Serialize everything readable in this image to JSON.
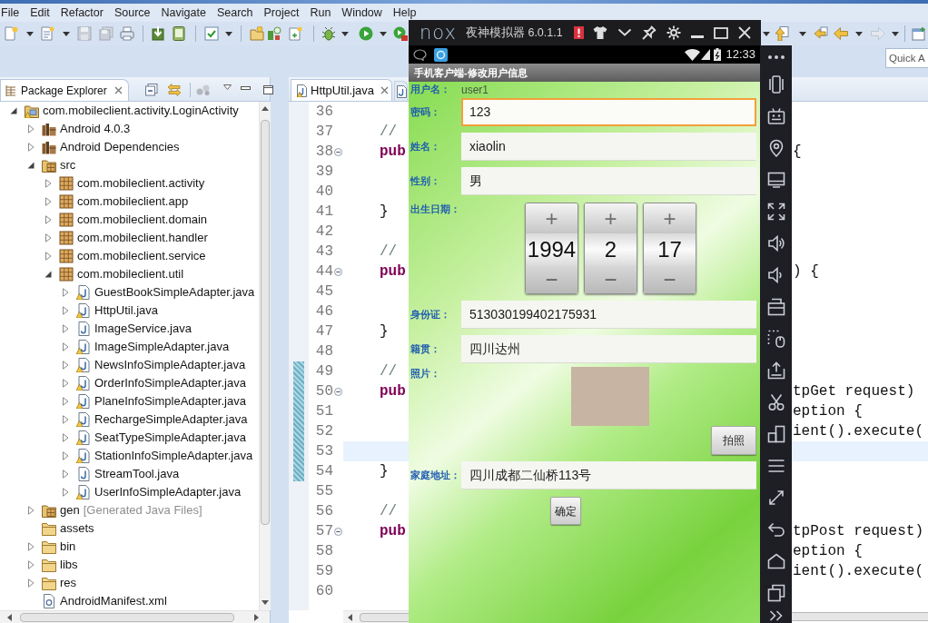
{
  "menu_bar": {
    "items": [
      "File",
      "Edit",
      "Refactor",
      "Source",
      "Navigate",
      "Search",
      "Project",
      "Run",
      "Window",
      "Help"
    ]
  },
  "quick_access": {
    "placeholder": "Quick A"
  },
  "package_explorer": {
    "title": "Package Explorer",
    "tree": [
      {
        "label": "com.mobileclient.activity.LoginActivity",
        "kind": "project",
        "expanded": true,
        "children": [
          {
            "label": "Android 4.0.3",
            "kind": "library",
            "expanded": false
          },
          {
            "label": "Android Dependencies",
            "kind": "library",
            "expanded": false
          },
          {
            "label": "src",
            "kind": "source-folder",
            "expanded": true,
            "children": [
              {
                "label": "com.mobileclient.activity",
                "kind": "package",
                "expanded": false
              },
              {
                "label": "com.mobileclient.app",
                "kind": "package",
                "expanded": false
              },
              {
                "label": "com.mobileclient.domain",
                "kind": "package",
                "expanded": false
              },
              {
                "label": "com.mobileclient.handler",
                "kind": "package",
                "expanded": false
              },
              {
                "label": "com.mobileclient.service",
                "kind": "package",
                "expanded": false
              },
              {
                "label": "com.mobileclient.util",
                "kind": "package",
                "expanded": true,
                "children": [
                  {
                    "label": "GuestBookSimpleAdapter.java",
                    "kind": "java",
                    "warning": true,
                    "expanded": false
                  },
                  {
                    "label": "HttpUtil.java",
                    "kind": "java",
                    "warning": true,
                    "expanded": false
                  },
                  {
                    "label": "ImageService.java",
                    "kind": "java",
                    "warning": false,
                    "expanded": false
                  },
                  {
                    "label": "ImageSimpleAdapter.java",
                    "kind": "java",
                    "warning": true,
                    "expanded": false
                  },
                  {
                    "label": "NewsInfoSimpleAdapter.java",
                    "kind": "java",
                    "warning": true,
                    "expanded": false
                  },
                  {
                    "label": "OrderInfoSimpleAdapter.java",
                    "kind": "java",
                    "warning": true,
                    "expanded": false
                  },
                  {
                    "label": "PlaneInfoSimpleAdapter.java",
                    "kind": "java",
                    "warning": true,
                    "expanded": false
                  },
                  {
                    "label": "RechargeSimpleAdapter.java",
                    "kind": "java",
                    "warning": true,
                    "expanded": false
                  },
                  {
                    "label": "SeatTypeSimpleAdapter.java",
                    "kind": "java",
                    "warning": true,
                    "expanded": false
                  },
                  {
                    "label": "StationInfoSimpleAdapter.java",
                    "kind": "java",
                    "warning": true,
                    "expanded": false
                  },
                  {
                    "label": "StreamTool.java",
                    "kind": "java",
                    "warning": false,
                    "expanded": false
                  },
                  {
                    "label": "UserInfoSimpleAdapter.java",
                    "kind": "java",
                    "warning": true,
                    "expanded": false
                  }
                ]
              }
            ]
          },
          {
            "label": "gen",
            "note": "[Generated Java Files]",
            "kind": "source-folder",
            "expanded": false
          },
          {
            "label": "assets",
            "kind": "folder"
          },
          {
            "label": "bin",
            "kind": "folder",
            "expanded": false
          },
          {
            "label": "libs",
            "kind": "folder",
            "expanded": false
          },
          {
            "label": "res",
            "kind": "folder",
            "expanded": false
          },
          {
            "label": "AndroidManifest.xml",
            "kind": "xml"
          }
        ]
      }
    ]
  },
  "editor": {
    "tabs": [
      {
        "label": "HttpUtil.java",
        "selected": true
      },
      {
        "selected": false
      }
    ],
    "lines": [
      {
        "number": "36",
        "fold": false,
        "changed": false,
        "current": false
      },
      {
        "number": "37",
        "code": {
          "text": "//",
          "kind": "comment"
        },
        "fold": false,
        "changed": false,
        "current": false
      },
      {
        "number": "38",
        "code": {
          "text": "pub",
          "kind": "keyword"
        },
        "right": "{",
        "fold": true,
        "changed": false,
        "current": false
      },
      {
        "number": "39",
        "fold": false,
        "changed": false,
        "current": false
      },
      {
        "number": "40",
        "fold": false,
        "changed": false,
        "current": false
      },
      {
        "number": "41",
        "code": {
          "text": "}",
          "kind": "plain"
        },
        "fold": false,
        "changed": false,
        "current": false
      },
      {
        "number": "42",
        "fold": false,
        "changed": false,
        "current": false
      },
      {
        "number": "43",
        "code": {
          "text": "//",
          "kind": "comment"
        },
        "fold": false,
        "changed": false,
        "current": false
      },
      {
        "number": "44",
        "code": {
          "text": "pub",
          "kind": "keyword"
        },
        "right": ") {",
        "fold": true,
        "changed": false,
        "current": false
      },
      {
        "number": "45",
        "fold": false,
        "changed": false,
        "current": false
      },
      {
        "number": "46",
        "fold": false,
        "changed": false,
        "current": false
      },
      {
        "number": "47",
        "code": {
          "text": "}",
          "kind": "plain"
        },
        "fold": false,
        "changed": false,
        "current": false
      },
      {
        "number": "48",
        "fold": false,
        "changed": false,
        "current": false
      },
      {
        "number": "49",
        "code": {
          "text": "//",
          "kind": "comment"
        },
        "fold": false,
        "changed": true,
        "current": false
      },
      {
        "number": "50",
        "code": {
          "text": "pub",
          "kind": "keyword"
        },
        "right": "tpGet request)",
        "fold": true,
        "changed": true,
        "current": false
      },
      {
        "number": "51",
        "right": "eption {",
        "fold": false,
        "changed": true,
        "current": false
      },
      {
        "number": "52",
        "right": "ient().execute(",
        "fold": false,
        "changed": true,
        "current": false
      },
      {
        "number": "53",
        "fold": false,
        "changed": true,
        "current": true
      },
      {
        "number": "54",
        "code": {
          "text": "}",
          "kind": "plain"
        },
        "fold": false,
        "changed": true,
        "current": false
      },
      {
        "number": "55",
        "fold": false,
        "changed": false,
        "current": false
      },
      {
        "number": "56",
        "code": {
          "text": "//",
          "kind": "comment"
        },
        "fold": false,
        "changed": false,
        "current": false
      },
      {
        "number": "57",
        "code": {
          "text": "pub",
          "kind": "keyword"
        },
        "right": "tpPost request)",
        "fold": true,
        "changed": false,
        "current": false
      },
      {
        "number": "58",
        "right": "eption {",
        "fold": false,
        "changed": false,
        "current": false
      },
      {
        "number": "59",
        "right": "ient().execute(",
        "fold": false,
        "changed": false,
        "current": false
      },
      {
        "number": "60",
        "fold": false,
        "changed": false,
        "current": false
      }
    ]
  },
  "emulator": {
    "logo": "nox",
    "title": "夜神模拟器 6.0.1.1",
    "status_time": "12:33",
    "app_title": "手机客户端-修改用户信息",
    "form": [
      {
        "kind": "static",
        "label": "用户名：",
        "value": "user1"
      },
      {
        "kind": "input",
        "label": "密码：",
        "value": "123",
        "focused": true
      },
      {
        "kind": "input",
        "label": "姓名：",
        "value": "xiaolin",
        "focused": false
      },
      {
        "kind": "input",
        "label": "性别：",
        "value": "男",
        "focused": false
      },
      {
        "kind": "date",
        "label": "出生日期：",
        "spinners": [
          {
            "plus": "+",
            "value": "1994",
            "minus": "−"
          },
          {
            "plus": "+",
            "value": "2",
            "minus": "−"
          },
          {
            "plus": "+",
            "value": "17",
            "minus": "−"
          }
        ]
      },
      {
        "kind": "input",
        "label": "身份证：",
        "value": "513030199402175931",
        "focused": false
      },
      {
        "kind": "input",
        "label": "籍贯：",
        "value": "四川达州",
        "focused": false
      },
      {
        "kind": "photo",
        "label": "照片：",
        "button": "拍照"
      },
      {
        "kind": "input",
        "label": "家庭地址：",
        "value": "四川成都二仙桥113号",
        "focused": false
      }
    ],
    "submit": "确定"
  }
}
